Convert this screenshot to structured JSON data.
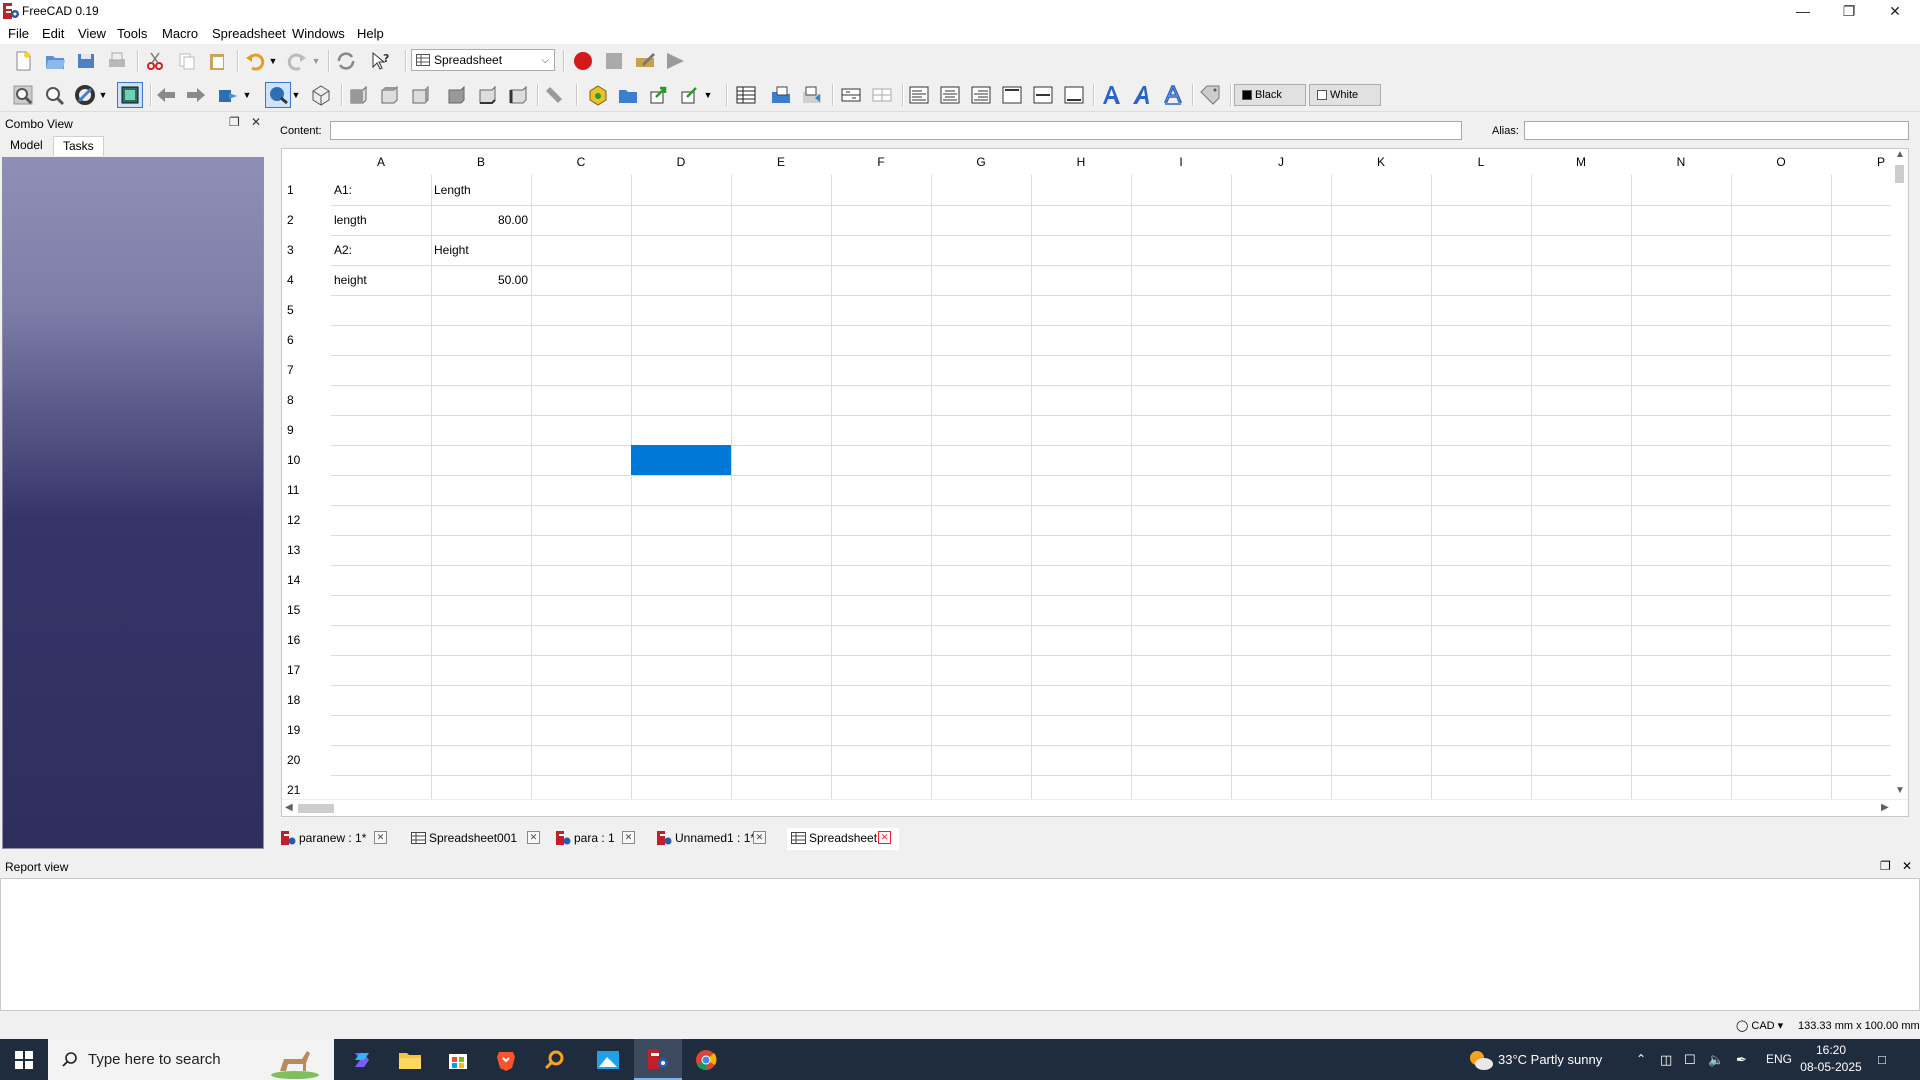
{
  "window": {
    "title": "FreeCAD 0.19"
  },
  "menu": [
    "File",
    "Edit",
    "View",
    "Tools",
    "Macro",
    "Spreadsheet",
    "Windows",
    "Help"
  ],
  "toolbar": {
    "workbench": "Spreadsheet",
    "color_black": "Black",
    "color_white": "White"
  },
  "combo_view": {
    "title": "Combo View",
    "tabs": [
      "Model",
      "Tasks"
    ],
    "active_tab": "Tasks"
  },
  "content_bar": {
    "content_label": "Content:",
    "content_value": "",
    "alias_label": "Alias:",
    "alias_value": ""
  },
  "spreadsheet": {
    "columns": [
      "A",
      "B",
      "C",
      "D",
      "E",
      "F",
      "G",
      "H",
      "I",
      "J",
      "K",
      "L",
      "M",
      "N",
      "O",
      "P"
    ],
    "rows": [
      "1",
      "2",
      "3",
      "4",
      "5",
      "6",
      "7",
      "8",
      "9",
      "10",
      "11",
      "12",
      "13",
      "14",
      "15",
      "16",
      "17",
      "18",
      "19",
      "20",
      "21"
    ],
    "cells": {
      "A1": "A1:",
      "B1": "Length",
      "A2": "length",
      "B2": "80.00",
      "A3": "A2:",
      "B3": "Height",
      "A4": "height",
      "B4": "50.00"
    },
    "selected": "D10"
  },
  "doc_tabs": [
    {
      "label": "paranew : 1*",
      "icon": "freecad-icon"
    },
    {
      "label": "Spreadsheet001",
      "icon": "spreadsheet-icon"
    },
    {
      "label": "para : 1",
      "icon": "freecad-icon"
    },
    {
      "label": "Unnamed1 : 1*",
      "icon": "freecad-icon"
    },
    {
      "label": "Spreadsheet",
      "icon": "spreadsheet-icon",
      "active": true
    }
  ],
  "report_view": {
    "title": "Report view"
  },
  "status_bar": {
    "nav_style": "CAD",
    "dimensions": "133.33 mm x 100.00 mm"
  },
  "taskbar": {
    "search_placeholder": "Type here to search",
    "weather": "33°C  Partly sunny",
    "language": "ENG",
    "time": "16:20",
    "date": "08-05-2025"
  }
}
